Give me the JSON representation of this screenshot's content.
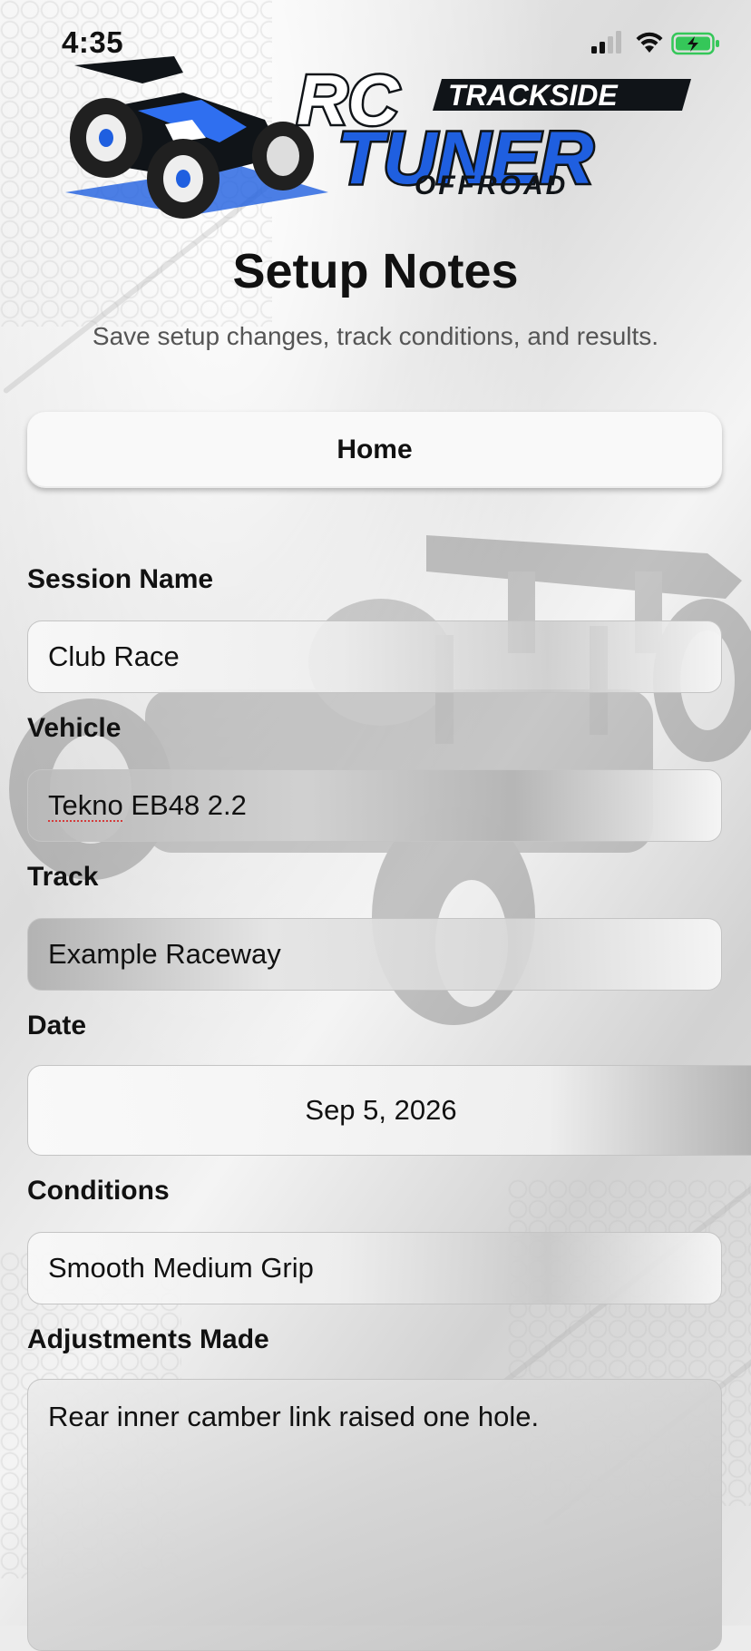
{
  "status_bar": {
    "time": "4:35"
  },
  "logo": {
    "line1": "RC",
    "line2": "TRACKSIDE",
    "line3": "TUNER",
    "line4": "OFFROAD"
  },
  "page": {
    "title": "Setup Notes",
    "subtitle": "Save setup changes, track conditions, and results."
  },
  "nav": {
    "home_label": "Home"
  },
  "form": {
    "session_name": {
      "label": "Session Name",
      "value": "Club Race"
    },
    "vehicle": {
      "label": "Vehicle",
      "value_word1": "Tekno",
      "value_rest": " EB48 2.2"
    },
    "track": {
      "label": "Track",
      "value": "Example Raceway"
    },
    "date": {
      "label": "Date",
      "value": "Sep 5, 2026"
    },
    "conditions": {
      "label": "Conditions",
      "value": "Smooth Medium Grip"
    },
    "adjustments": {
      "label": "Adjustments Made",
      "value": "Rear inner camber link raised one hole."
    }
  },
  "colors": {
    "brand_blue": "#1f5fe0",
    "brand_dark": "#101418",
    "battery_green": "#35c759"
  },
  "icons": {
    "signal": "cellular-signal-icon",
    "wifi": "wifi-icon",
    "battery": "battery-charging-icon"
  }
}
